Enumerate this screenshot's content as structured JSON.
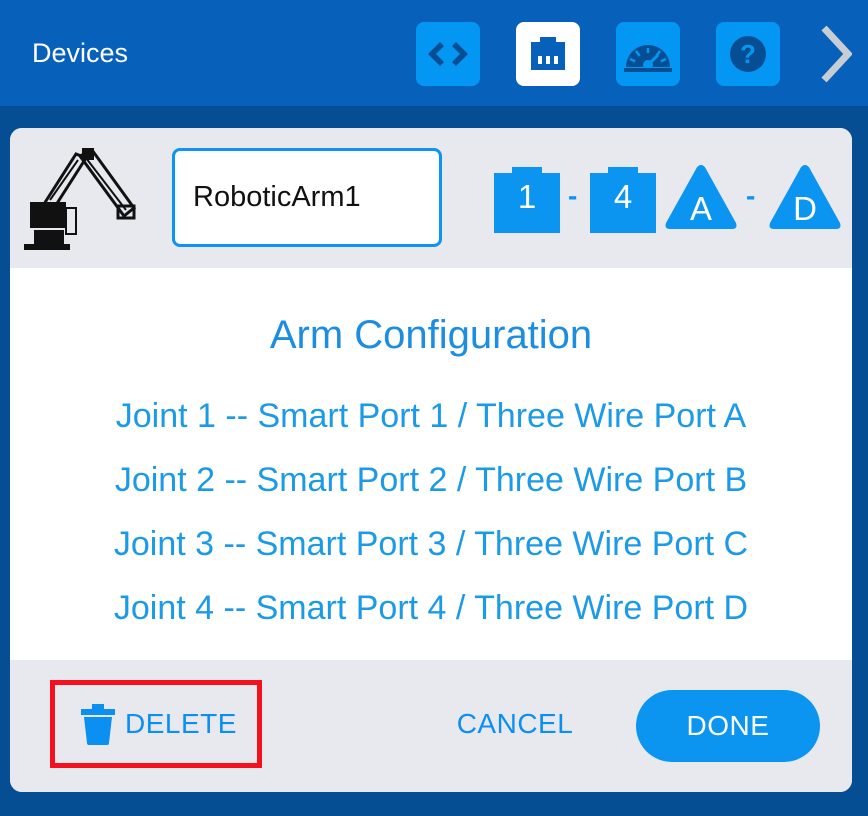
{
  "header": {
    "title": "Devices",
    "tools": [
      {
        "icon": "code-brackets-icon",
        "active": false
      },
      {
        "icon": "ethernet-port-icon",
        "active": true
      },
      {
        "icon": "speedometer-icon",
        "active": false
      },
      {
        "icon": "help-icon",
        "active": false
      }
    ],
    "more_icon": "chevron-right-icon",
    "help_glyph": "?"
  },
  "device": {
    "icon": "robotic-arm-icon",
    "name": "RoboticArm1",
    "smart_ports": {
      "from": "1",
      "to": "4"
    },
    "three_wire_ports": {
      "from": "A",
      "to": "D"
    },
    "separator": "-"
  },
  "configuration": {
    "title": "Arm Configuration",
    "joints": [
      "Joint 1 -- Smart Port 1 / Three Wire Port A",
      "Joint 2 -- Smart Port 2 / Three Wire Port B",
      "Joint 3 -- Smart Port 3 / Three Wire Port C",
      "Joint 4 -- Smart Port 4 / Three Wire Port D"
    ]
  },
  "footer": {
    "delete_label": "DELETE",
    "delete_icon": "trash-icon",
    "cancel_label": "CANCEL",
    "done_label": "DONE"
  },
  "colors": {
    "topbar": "#0760b9",
    "background": "#064e93",
    "accent": "#0b95f0",
    "highlight": "#f4101d"
  }
}
